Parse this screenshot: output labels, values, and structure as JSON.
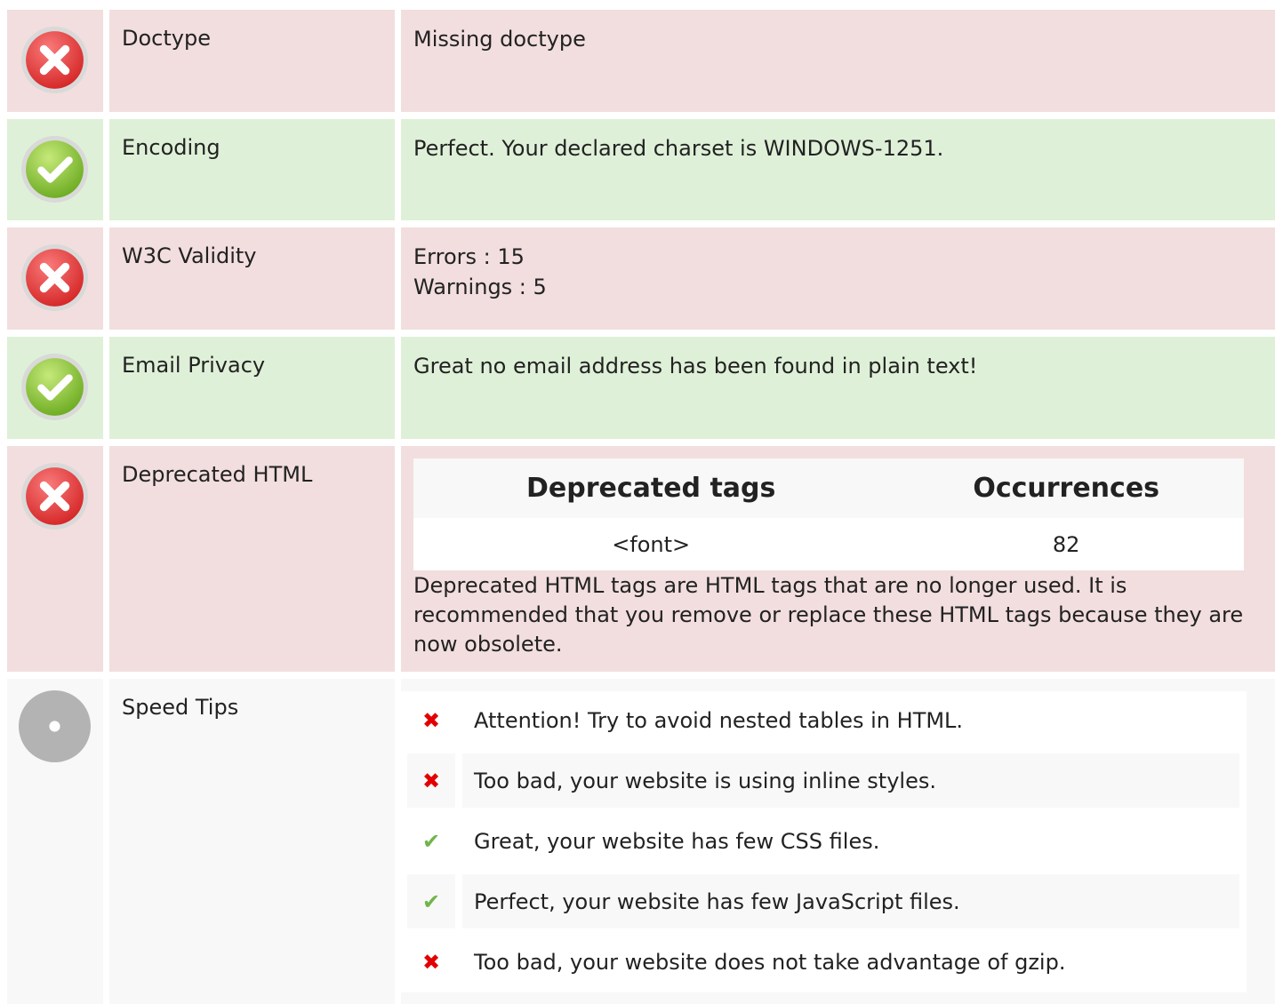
{
  "colors": {
    "error_bg": "#f2dede",
    "success_bg": "#dff0d8",
    "neutral_bg": "#f8f8f8",
    "error_icon": "#e53a3a",
    "success_icon": "#7ac143",
    "neutral_icon": "#b3b3b3",
    "tip_bad": "#e30000",
    "tip_good": "#6fb54a"
  },
  "rows": {
    "doctype": {
      "status": "error",
      "icon": "error-x-icon",
      "label": "Doctype",
      "value": "Missing doctype"
    },
    "encoding": {
      "status": "success",
      "icon": "success-check-icon",
      "label": "Encoding",
      "value": "Perfect. Your declared charset is WINDOWS-1251."
    },
    "w3c": {
      "status": "error",
      "icon": "error-x-icon",
      "label": "W3C Validity",
      "errors": "Errors : 15",
      "warnings": "Warnings : 5"
    },
    "email": {
      "status": "success",
      "icon": "success-check-icon",
      "label": "Email Privacy",
      "value": "Great no email address has been found in plain text!"
    },
    "deprecated": {
      "status": "error",
      "icon": "error-x-icon",
      "label": "Deprecated HTML",
      "table": {
        "headers": [
          "Deprecated tags",
          "Occurrences"
        ],
        "rows": [
          {
            "tag": "<font>",
            "count": "82"
          }
        ]
      },
      "note": "Deprecated HTML tags are HTML tags that are no longer used. It is recommended that you remove or replace these HTML tags because they are now obsolete."
    },
    "speed": {
      "status": "neutral",
      "icon": "neutral-dot-icon",
      "label": "Speed Tips",
      "tips": [
        {
          "mark": "✖",
          "kind": "bad",
          "icon": "cross-icon",
          "text": "Attention! Try to avoid nested tables in HTML."
        },
        {
          "mark": "✖",
          "kind": "bad",
          "icon": "cross-icon",
          "text": "Too bad, your website is using inline styles."
        },
        {
          "mark": "✔",
          "kind": "good",
          "icon": "check-icon",
          "text": "Great, your website has few CSS files."
        },
        {
          "mark": "✔",
          "kind": "good",
          "icon": "check-icon",
          "text": "Perfect, your website has few JavaScript files."
        },
        {
          "mark": "✖",
          "kind": "bad",
          "icon": "cross-icon",
          "text": "Too bad, your website does not take advantage of gzip."
        }
      ]
    }
  }
}
